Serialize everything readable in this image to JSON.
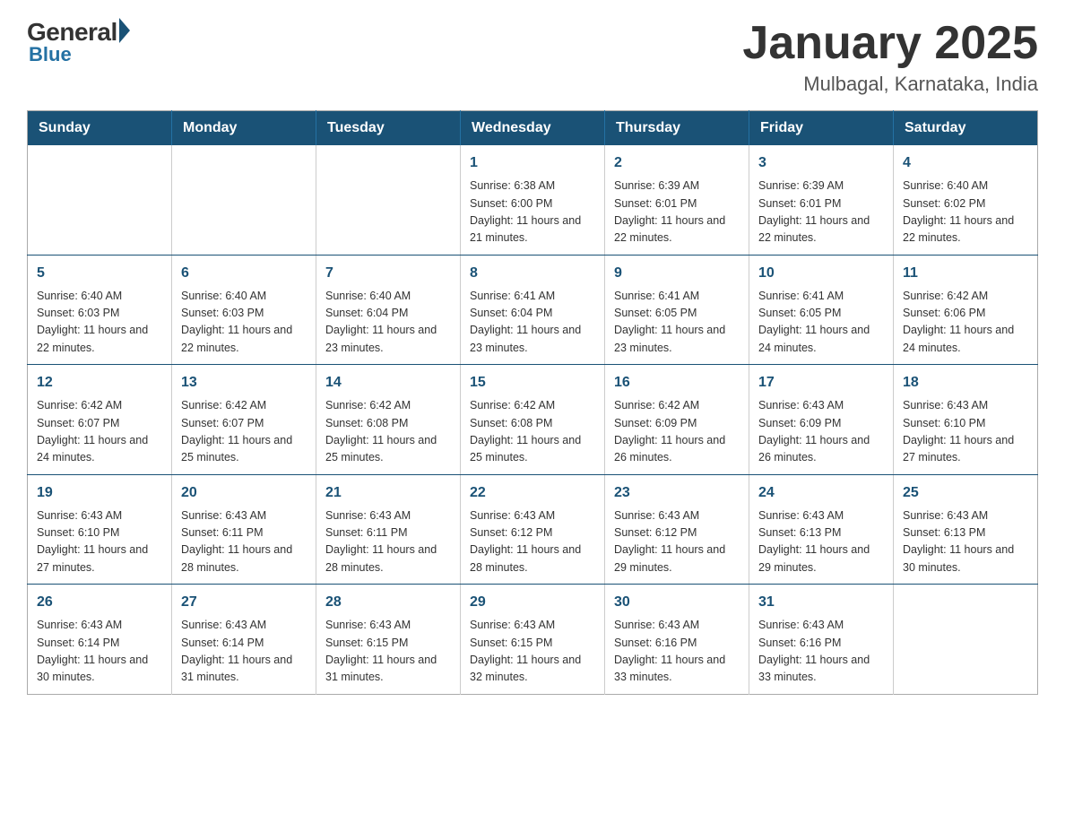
{
  "logo": {
    "general": "General",
    "blue": "Blue"
  },
  "header": {
    "month": "January 2025",
    "location": "Mulbagal, Karnataka, India"
  },
  "weekdays": [
    "Sunday",
    "Monday",
    "Tuesday",
    "Wednesday",
    "Thursday",
    "Friday",
    "Saturday"
  ],
  "weeks": [
    [
      {
        "day": "",
        "info": ""
      },
      {
        "day": "",
        "info": ""
      },
      {
        "day": "",
        "info": ""
      },
      {
        "day": "1",
        "info": "Sunrise: 6:38 AM\nSunset: 6:00 PM\nDaylight: 11 hours\nand 21 minutes."
      },
      {
        "day": "2",
        "info": "Sunrise: 6:39 AM\nSunset: 6:01 PM\nDaylight: 11 hours\nand 22 minutes."
      },
      {
        "day": "3",
        "info": "Sunrise: 6:39 AM\nSunset: 6:01 PM\nDaylight: 11 hours\nand 22 minutes."
      },
      {
        "day": "4",
        "info": "Sunrise: 6:40 AM\nSunset: 6:02 PM\nDaylight: 11 hours\nand 22 minutes."
      }
    ],
    [
      {
        "day": "5",
        "info": "Sunrise: 6:40 AM\nSunset: 6:03 PM\nDaylight: 11 hours\nand 22 minutes."
      },
      {
        "day": "6",
        "info": "Sunrise: 6:40 AM\nSunset: 6:03 PM\nDaylight: 11 hours\nand 22 minutes."
      },
      {
        "day": "7",
        "info": "Sunrise: 6:40 AM\nSunset: 6:04 PM\nDaylight: 11 hours\nand 23 minutes."
      },
      {
        "day": "8",
        "info": "Sunrise: 6:41 AM\nSunset: 6:04 PM\nDaylight: 11 hours\nand 23 minutes."
      },
      {
        "day": "9",
        "info": "Sunrise: 6:41 AM\nSunset: 6:05 PM\nDaylight: 11 hours\nand 23 minutes."
      },
      {
        "day": "10",
        "info": "Sunrise: 6:41 AM\nSunset: 6:05 PM\nDaylight: 11 hours\nand 24 minutes."
      },
      {
        "day": "11",
        "info": "Sunrise: 6:42 AM\nSunset: 6:06 PM\nDaylight: 11 hours\nand 24 minutes."
      }
    ],
    [
      {
        "day": "12",
        "info": "Sunrise: 6:42 AM\nSunset: 6:07 PM\nDaylight: 11 hours\nand 24 minutes."
      },
      {
        "day": "13",
        "info": "Sunrise: 6:42 AM\nSunset: 6:07 PM\nDaylight: 11 hours\nand 25 minutes."
      },
      {
        "day": "14",
        "info": "Sunrise: 6:42 AM\nSunset: 6:08 PM\nDaylight: 11 hours\nand 25 minutes."
      },
      {
        "day": "15",
        "info": "Sunrise: 6:42 AM\nSunset: 6:08 PM\nDaylight: 11 hours\nand 25 minutes."
      },
      {
        "day": "16",
        "info": "Sunrise: 6:42 AM\nSunset: 6:09 PM\nDaylight: 11 hours\nand 26 minutes."
      },
      {
        "day": "17",
        "info": "Sunrise: 6:43 AM\nSunset: 6:09 PM\nDaylight: 11 hours\nand 26 minutes."
      },
      {
        "day": "18",
        "info": "Sunrise: 6:43 AM\nSunset: 6:10 PM\nDaylight: 11 hours\nand 27 minutes."
      }
    ],
    [
      {
        "day": "19",
        "info": "Sunrise: 6:43 AM\nSunset: 6:10 PM\nDaylight: 11 hours\nand 27 minutes."
      },
      {
        "day": "20",
        "info": "Sunrise: 6:43 AM\nSunset: 6:11 PM\nDaylight: 11 hours\nand 28 minutes."
      },
      {
        "day": "21",
        "info": "Sunrise: 6:43 AM\nSunset: 6:11 PM\nDaylight: 11 hours\nand 28 minutes."
      },
      {
        "day": "22",
        "info": "Sunrise: 6:43 AM\nSunset: 6:12 PM\nDaylight: 11 hours\nand 28 minutes."
      },
      {
        "day": "23",
        "info": "Sunrise: 6:43 AM\nSunset: 6:12 PM\nDaylight: 11 hours\nand 29 minutes."
      },
      {
        "day": "24",
        "info": "Sunrise: 6:43 AM\nSunset: 6:13 PM\nDaylight: 11 hours\nand 29 minutes."
      },
      {
        "day": "25",
        "info": "Sunrise: 6:43 AM\nSunset: 6:13 PM\nDaylight: 11 hours\nand 30 minutes."
      }
    ],
    [
      {
        "day": "26",
        "info": "Sunrise: 6:43 AM\nSunset: 6:14 PM\nDaylight: 11 hours\nand 30 minutes."
      },
      {
        "day": "27",
        "info": "Sunrise: 6:43 AM\nSunset: 6:14 PM\nDaylight: 11 hours\nand 31 minutes."
      },
      {
        "day": "28",
        "info": "Sunrise: 6:43 AM\nSunset: 6:15 PM\nDaylight: 11 hours\nand 31 minutes."
      },
      {
        "day": "29",
        "info": "Sunrise: 6:43 AM\nSunset: 6:15 PM\nDaylight: 11 hours\nand 32 minutes."
      },
      {
        "day": "30",
        "info": "Sunrise: 6:43 AM\nSunset: 6:16 PM\nDaylight: 11 hours\nand 33 minutes."
      },
      {
        "day": "31",
        "info": "Sunrise: 6:43 AM\nSunset: 6:16 PM\nDaylight: 11 hours\nand 33 minutes."
      },
      {
        "day": "",
        "info": ""
      }
    ]
  ]
}
